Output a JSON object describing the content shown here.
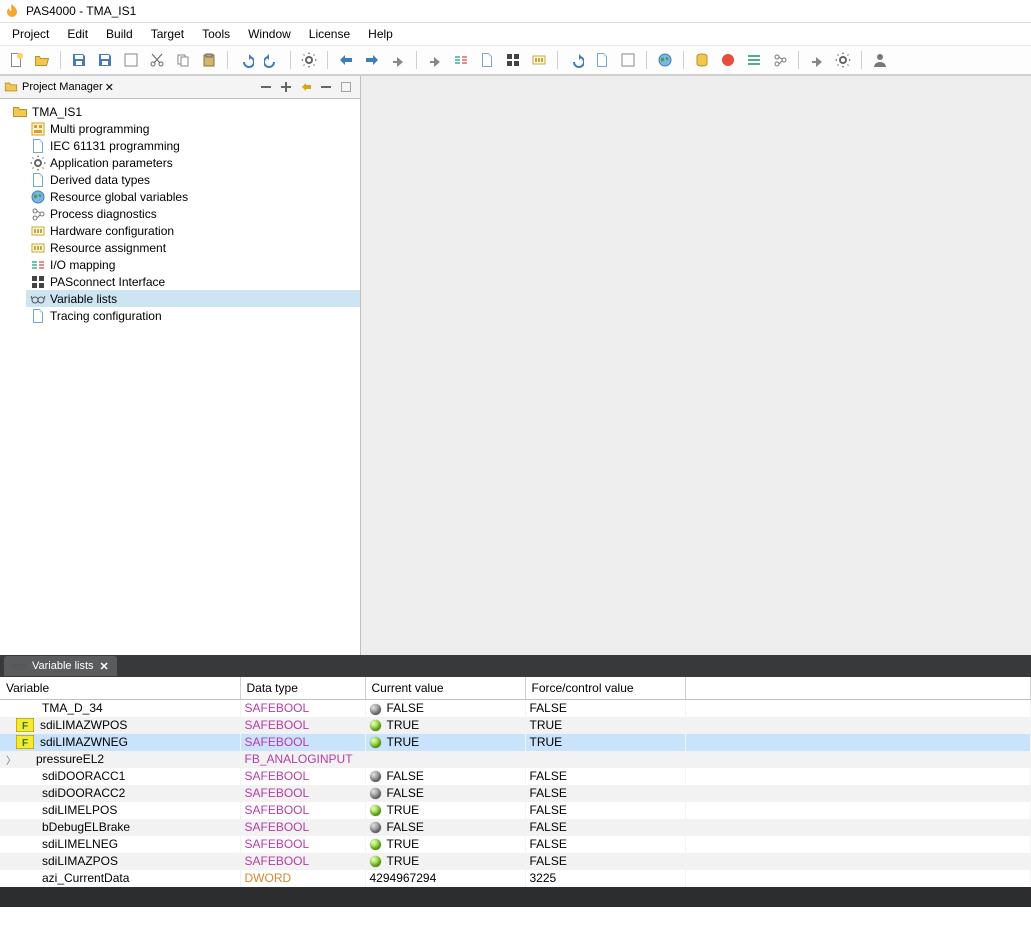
{
  "title": "PAS4000 - TMA_IS1",
  "menu": {
    "items": [
      "Project",
      "Edit",
      "Build",
      "Target",
      "Tools",
      "Window",
      "License",
      "Help"
    ]
  },
  "pm": {
    "header": "Project Manager",
    "root": "TMA_IS1",
    "items": [
      {
        "label": "Multi programming"
      },
      {
        "label": "IEC 61131 programming"
      },
      {
        "label": "Application parameters"
      },
      {
        "label": "Derived data types"
      },
      {
        "label": "Resource global variables"
      },
      {
        "label": "Process diagnostics"
      },
      {
        "label": "Hardware configuration"
      },
      {
        "label": "Resource assignment"
      },
      {
        "label": "I/O mapping"
      },
      {
        "label": "PASconnect Interface"
      },
      {
        "label": "Variable lists",
        "selected": true
      },
      {
        "label": "Tracing configuration"
      }
    ]
  },
  "varlist": {
    "tab": "Variable lists",
    "columns": {
      "variable": "Variable",
      "datatype": "Data type",
      "current": "Current value",
      "force": "Force/control value"
    },
    "rows": [
      {
        "name": "TMA_D_34",
        "dt": "SAFEBOOL",
        "dtClass": "dt-safebool",
        "cv": "FALSE",
        "led": "false",
        "fv": "FALSE",
        "row": "normal"
      },
      {
        "name": "sdiLIMAZWPOS",
        "dt": "SAFEBOOL",
        "dtClass": "dt-safebool",
        "cv": "TRUE",
        "led": "true",
        "fv": "TRUE",
        "row": "gray",
        "flag": true
      },
      {
        "name": "sdiLIMAZWNEG",
        "dt": "SAFEBOOL",
        "dtClass": "dt-safebool",
        "cv": "TRUE",
        "led": "true",
        "fv": "TRUE",
        "row": "sel",
        "flag": true
      },
      {
        "name": "pressureEL2",
        "dt": "FB_ANALOGINPUT",
        "dtClass": "dt-fb",
        "cv": "",
        "led": "",
        "fv": "",
        "row": "gray",
        "expand": true
      },
      {
        "name": "sdiDOORACC1",
        "dt": "SAFEBOOL",
        "dtClass": "dt-safebool",
        "cv": "FALSE",
        "led": "false",
        "fv": "FALSE",
        "row": "normal"
      },
      {
        "name": "sdiDOORACC2",
        "dt": "SAFEBOOL",
        "dtClass": "dt-safebool",
        "cv": "FALSE",
        "led": "false",
        "fv": "FALSE",
        "row": "gray"
      },
      {
        "name": "sdiLIMELPOS",
        "dt": "SAFEBOOL",
        "dtClass": "dt-safebool",
        "cv": "TRUE",
        "led": "true",
        "fv": "FALSE",
        "row": "normal"
      },
      {
        "name": "bDebugELBrake",
        "dt": "SAFEBOOL",
        "dtClass": "dt-safebool",
        "cv": "FALSE",
        "led": "false",
        "fv": "FALSE",
        "row": "gray"
      },
      {
        "name": "sdiLIMELNEG",
        "dt": "SAFEBOOL",
        "dtClass": "dt-safebool",
        "cv": "TRUE",
        "led": "true",
        "fv": "FALSE",
        "row": "normal"
      },
      {
        "name": "sdiLIMAZPOS",
        "dt": "SAFEBOOL",
        "dtClass": "dt-safebool",
        "cv": "TRUE",
        "led": "true",
        "fv": "FALSE",
        "row": "gray"
      },
      {
        "name": "azi_CurrentData",
        "dt": "DWORD",
        "dtClass": "dt-dword",
        "cv": "4294967294",
        "led": "",
        "fv": "3225",
        "row": "normal"
      }
    ]
  },
  "status": ""
}
